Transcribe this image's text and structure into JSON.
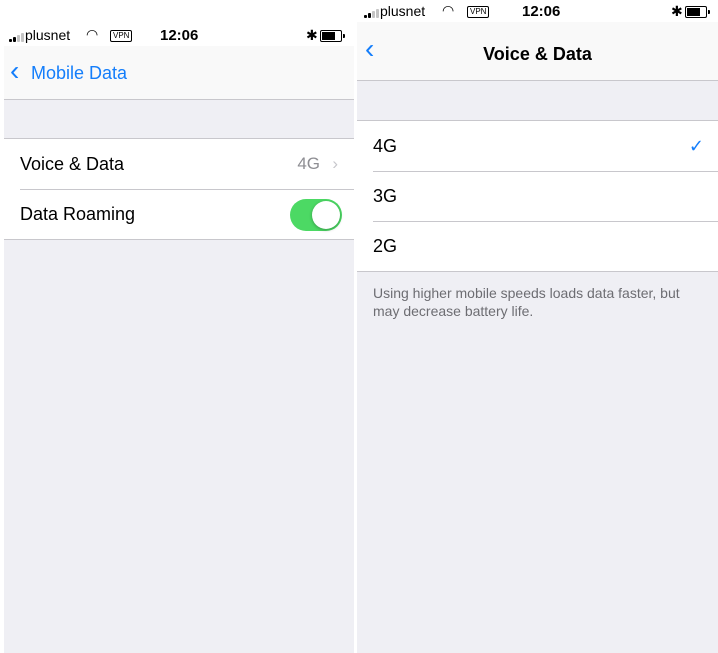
{
  "status_bar": {
    "carrier": "plusnet",
    "vpn": "VPN",
    "time": "12:06",
    "wifi_icon": "wifi-icon",
    "bluetooth_icon": "bluetooth-icon",
    "battery_icon": "battery-icon",
    "signal_bars_on": 2,
    "signal_bars_total": 4
  },
  "left_screen": {
    "back_label": "Mobile Data",
    "rows": [
      {
        "label": "Voice & Data",
        "value": "4G"
      },
      {
        "label": "Data Roaming",
        "toggle_on": true
      }
    ]
  },
  "right_screen": {
    "title": "Voice & Data",
    "options": [
      {
        "label": "4G",
        "selected": true
      },
      {
        "label": "3G",
        "selected": false
      },
      {
        "label": "2G",
        "selected": false
      }
    ],
    "footer": "Using higher mobile speeds loads data faster, but may decrease battery life."
  },
  "colors": {
    "accent": "#147efb",
    "toggle_on": "#4cd964",
    "grouped_background": "#efeff4",
    "separator": "#c8c7cc",
    "secondary_text": "#8e8e93"
  }
}
